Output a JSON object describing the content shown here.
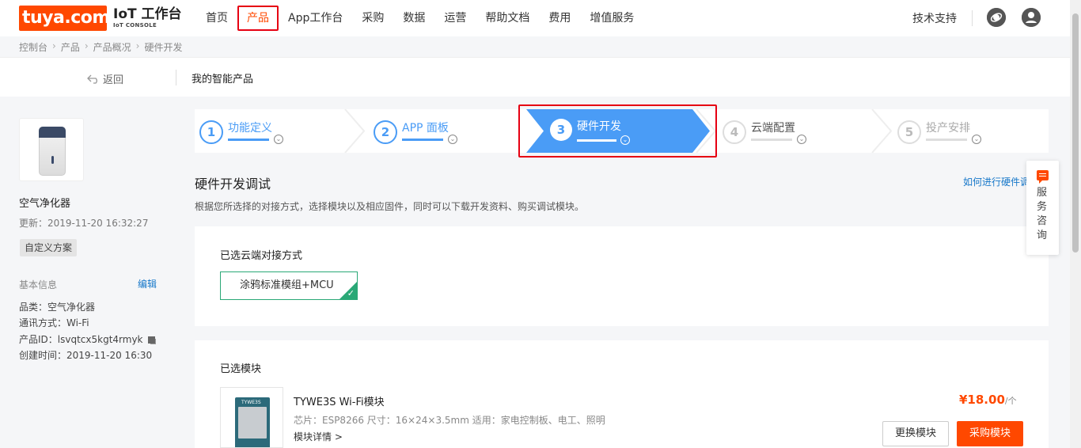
{
  "header": {
    "logo_text": "tuya.com",
    "logo_title": "IoT 工作台",
    "logo_subtitle": "IoT CONSOLE",
    "nav": [
      "首页",
      "产品",
      "App工作台",
      "采购",
      "数据",
      "运营",
      "帮助文档",
      "费用",
      "增值服务"
    ],
    "nav_active_index": 1,
    "support": "技术支持"
  },
  "breadcrumb": [
    "控制台",
    "产品",
    "产品概况",
    "硬件开发"
  ],
  "subbar": {
    "back": "返回",
    "title": "我的智能产品"
  },
  "sidebar": {
    "product_name": "空气净化器",
    "updated": "更新：2019-11-20 16:32:27",
    "tag": "自定义方案",
    "basic_info_title": "基本信息",
    "edit": "编辑",
    "category": "品类：空气净化器",
    "protocol": "通讯方式：Wi-Fi",
    "product_id": "产品ID：lsvqtcx5kgt4rmyk",
    "created": "创建时间：2019-11-20 16:30"
  },
  "steps": [
    {
      "num": "1",
      "label": "功能定义",
      "state": "done"
    },
    {
      "num": "2",
      "label": "APP 面板",
      "state": "done"
    },
    {
      "num": "3",
      "label": "硬件开发",
      "state": "active"
    },
    {
      "num": "4",
      "label": "云端配置",
      "state": "todo"
    },
    {
      "num": "5",
      "label": "投产安排",
      "state": "todo"
    }
  ],
  "main": {
    "section_title": "硬件开发调试",
    "help_link": "如何进行硬件调",
    "section_desc": "根据您所选择的对接方式，选择模块以及相应固件，同时可以下载开发资料、购买调试模块。",
    "access_title": "已选云端对接方式",
    "access_value": "涂鸦标准模组+MCU",
    "module_title": "已选模块",
    "module_img_label": "TYWE3S",
    "module_name": "TYWE3S Wi-Fi模块",
    "module_spec": "芯片：ESP8266   尺寸：16×24×3.5mm   适用：家电控制板、电工、照明",
    "module_detail": "模块详情 >",
    "price": "¥18.00",
    "price_unit": "/个",
    "btn_change": "更换模块",
    "btn_buy": "采购模块"
  },
  "consult": {
    "text": "服务咨询"
  },
  "colors": {
    "brand": "#ff4800",
    "step_blue": "#4a9cf6",
    "link": "#1677c9",
    "success": "#2aa876"
  }
}
